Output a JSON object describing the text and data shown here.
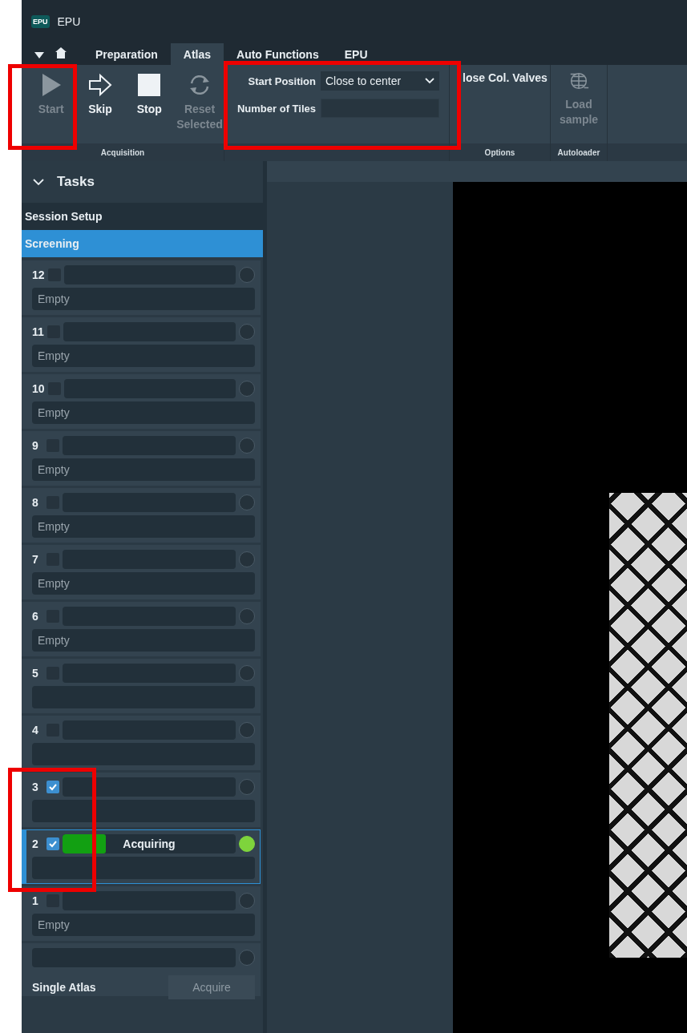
{
  "window": {
    "logo": "EPU",
    "title": "EPU"
  },
  "menu_tabs": [
    {
      "label": "Preparation",
      "selected": false
    },
    {
      "label": "Atlas",
      "selected": true
    },
    {
      "label": "Auto Functions",
      "selected": false
    },
    {
      "label": "EPU",
      "selected": false
    }
  ],
  "ribbon": {
    "acquisition": {
      "group_label": "Acquisition",
      "buttons": [
        {
          "label": "Start",
          "kind": "play",
          "disabled": true
        },
        {
          "label": "Skip",
          "kind": "skip",
          "disabled": false
        },
        {
          "label": "Stop",
          "kind": "stop",
          "disabled": false
        },
        {
          "label": "Reset Selected",
          "kind": "reset",
          "disabled": true
        }
      ]
    },
    "atlas_settings": {
      "start_position_label": "Start Position",
      "start_position_value": "Close to center",
      "tiles_label": "Number of Tiles"
    },
    "options": {
      "group_label": "Options",
      "valves_label": "lose Col. Valves"
    },
    "autoloader": {
      "group_label": "Autoloader",
      "button": {
        "label": "Load sample",
        "disabled": true
      }
    }
  },
  "tasks": {
    "title": "Tasks",
    "expanded": true,
    "items": [
      {
        "label": "Session Setup",
        "selected": false
      },
      {
        "label": "Screening",
        "selected": true
      }
    ]
  },
  "grid_slots": [
    {
      "number": "12",
      "checked": false,
      "active": false,
      "selected": false,
      "note": "Empty"
    },
    {
      "number": "11",
      "checked": false,
      "active": false,
      "selected": false,
      "note": "Empty"
    },
    {
      "number": "10",
      "checked": false,
      "active": false,
      "selected": false,
      "note": "Empty"
    },
    {
      "number": "9",
      "checked": false,
      "active": false,
      "selected": false,
      "note": "Empty"
    },
    {
      "number": "8",
      "checked": false,
      "active": false,
      "selected": false,
      "note": "Empty"
    },
    {
      "number": "7",
      "checked": false,
      "active": false,
      "selected": false,
      "note": "Empty"
    },
    {
      "number": "6",
      "checked": false,
      "active": false,
      "selected": false,
      "note": "Empty"
    },
    {
      "number": "5",
      "checked": false,
      "active": false,
      "selected": false
    },
    {
      "number": "4",
      "checked": false,
      "active": false,
      "selected": false
    },
    {
      "number": "3",
      "checked": true,
      "active": false,
      "selected": false
    },
    {
      "number": "2",
      "checked": true,
      "active": true,
      "selected": true,
      "status": "Acquiring",
      "level": 0.25
    },
    {
      "number": "1",
      "checked": false,
      "active": false,
      "selected": false,
      "note": "Empty"
    }
  ],
  "single_atlas": {
    "active": false,
    "label": "Single Atlas",
    "button": "Acquire"
  }
}
